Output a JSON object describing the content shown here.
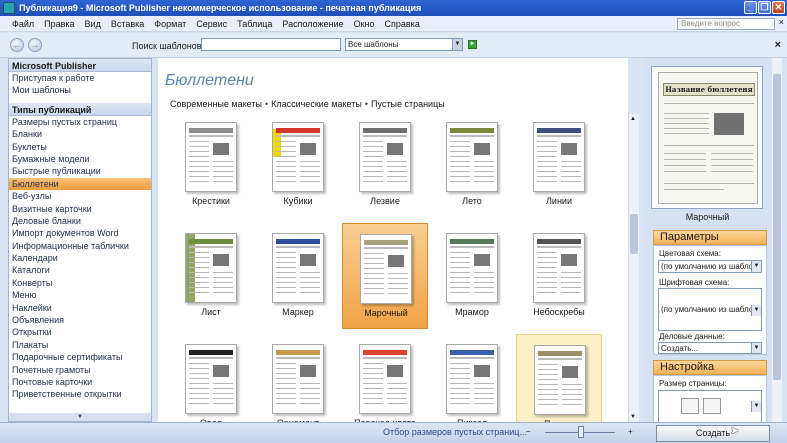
{
  "window": {
    "title": "Публикация9 - Microsoft Publisher некоммерческое использование - печатная публикация",
    "buttons": [
      "_",
      "❐",
      "✕"
    ]
  },
  "menubar": {
    "items": [
      "Файл",
      "Правка",
      "Вид",
      "Вставка",
      "Формат",
      "Сервис",
      "Таблица",
      "Расположение",
      "Окно",
      "Справка"
    ],
    "question_placeholder": "Введите вопрос",
    "close_glyph": "×"
  },
  "toolbar": {
    "back_glyph": "←",
    "forward_glyph": "→",
    "search_label": "Поиск шаблонов:",
    "search_value": "",
    "scope_value": "Все шаблоны",
    "go_glyph": "►",
    "close_glyph": "×"
  },
  "left_pane": {
    "header1": "Microsoft Publisher",
    "links1": [
      "Приступая к работе",
      "Мои шаблоны"
    ],
    "header2": "Типы публикаций",
    "types": [
      "Размеры пустых страниц",
      "Бланки",
      "Буклеты",
      "Бумажные модели",
      "Быстрые публикации",
      "Бюллетени",
      "Веб-узлы",
      "Визитные карточки",
      "Деловые бланки",
      "Импорт документов Word",
      "Информационные таблички",
      "Календари",
      "Каталоги",
      "Конверты",
      "Меню",
      "Наклейки",
      "Объявления",
      "Открытки",
      "Плакаты",
      "Подарочные сертификаты",
      "Почетные грамоты",
      "Почтовые карточки",
      "Приветственные открытки"
    ],
    "selected_index": 5,
    "scroll_glyph": "▼"
  },
  "center": {
    "category_title": "Бюллетени",
    "filters": [
      "Современные макеты",
      "Классические макеты",
      "Пустые страницы"
    ],
    "separator": "•",
    "templates": [
      {
        "label": "Крестики",
        "accent": "#8c8c8c",
        "side": "none"
      },
      {
        "label": "Кубики",
        "accent": "#d6372b",
        "side": "yellow"
      },
      {
        "label": "Лезвие",
        "accent": "#6f6f6f",
        "side": "none"
      },
      {
        "label": "Лето",
        "accent": "#7a8a3a",
        "side": "none"
      },
      {
        "label": "Линии",
        "accent": "#3f4f7f",
        "side": "none"
      },
      {
        "label": "Лист",
        "accent": "#6b8f3a",
        "side": "green"
      },
      {
        "label": "Маркер",
        "accent": "#2c4f9c",
        "side": "none"
      },
      {
        "label": "Марочный",
        "accent": "#a8a27a",
        "side": "none"
      },
      {
        "label": "Мрамор",
        "accent": "#56785a",
        "side": "none"
      },
      {
        "label": "Небоскребы",
        "accent": "#555555",
        "side": "none"
      },
      {
        "label": "Овал",
        "accent": "#222222",
        "side": "none"
      },
      {
        "label": "Орнамент",
        "accent": "#c79a4a",
        "side": "none"
      },
      {
        "label": "Переход цвета",
        "accent": "#d9462b",
        "side": "none"
      },
      {
        "label": "Пиксел",
        "accent": "#3b5fae",
        "side": "none"
      },
      {
        "label": "Пласты",
        "accent": "#9a8f6a",
        "side": "none"
      }
    ],
    "selected_index": 7,
    "hover_index": 14
  },
  "right_pane": {
    "preview_title": "Название бюллетеня",
    "preview_label": "Марочный",
    "params_header": "Параметры",
    "color_scheme_label": "Цветовая схема:",
    "color_scheme_value": "(по умолчанию из шаблона)",
    "font_scheme_label": "Шрифтовая схема:",
    "font_scheme_value": "(по умолчанию из шаблона)",
    "business_data_label": "Деловые данные:",
    "business_data_value": "Создать...",
    "setup_header": "Настройка",
    "page_size_label": "Размер страницы:"
  },
  "statusbar": {
    "text": "Отбор размеров пустых страниц...",
    "zoom_minus": "−",
    "zoom_plus": "+",
    "create_label": "Создать"
  },
  "colors": {
    "selection": "#f0a447",
    "accent_blue": "#5b82b5",
    "title_bar": "#2f64d4"
  }
}
